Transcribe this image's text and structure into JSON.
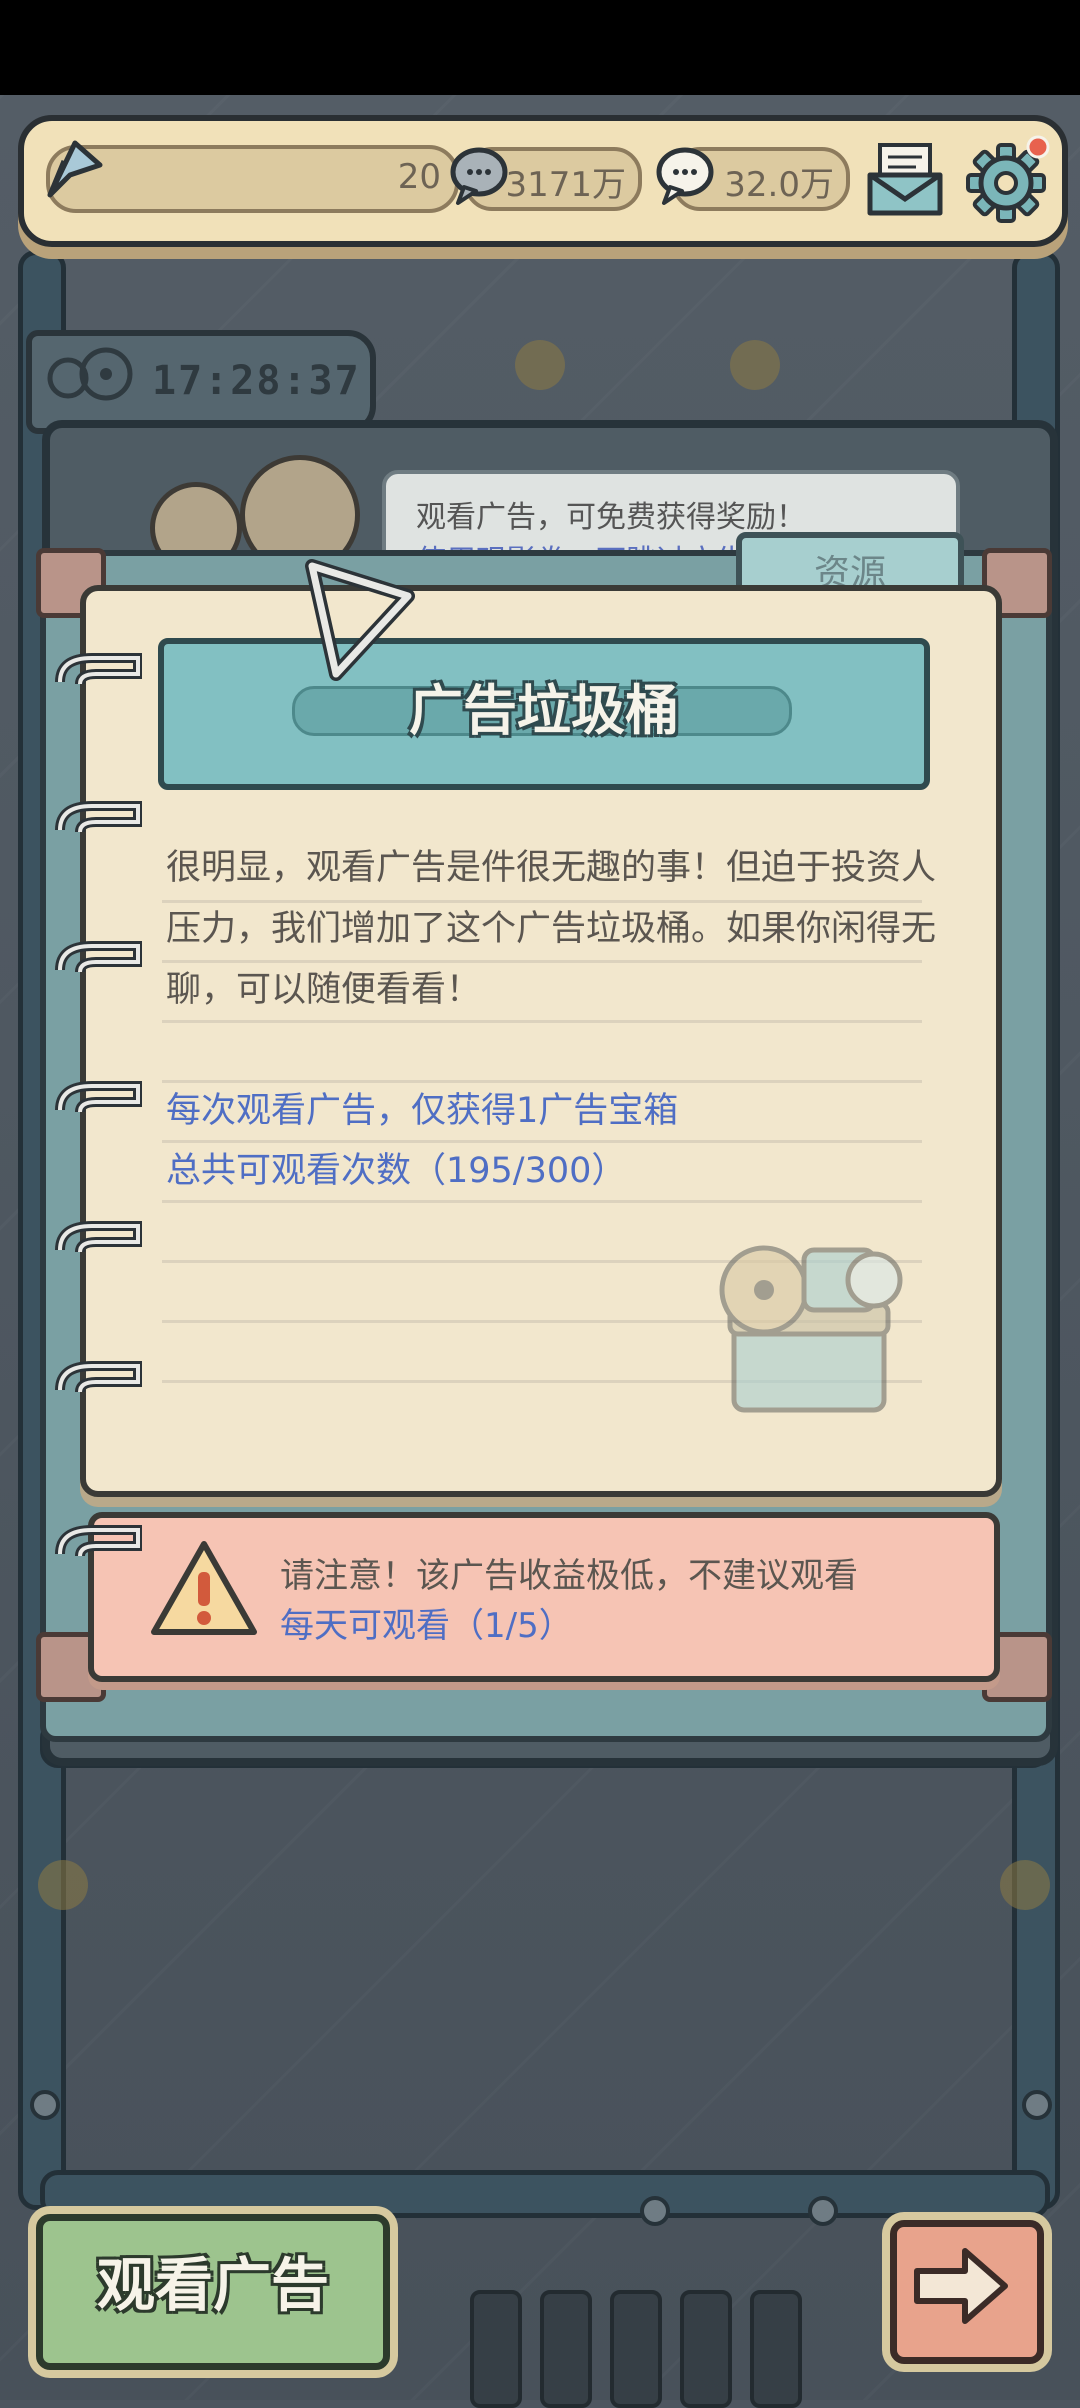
{
  "topbar": {
    "level_value": "20",
    "currency_1": "3171万",
    "currency_2": "32.0万"
  },
  "timer": {
    "value": "17:28:37"
  },
  "behind_hint": {
    "line1": "观看广告，可免费获得奖励！",
    "line2": "使用观影券，可跳过广告"
  },
  "dialog": {
    "tab_label": "资源",
    "title": "广告垃圾桶",
    "body": "很明显，观看广告是件很无趣的事！但迫于投资人压力，我们增加了这个广告垃圾桶。如果你闲得无聊，可以随便看看！",
    "reward_line": "每次观看广告，仅获得1广告宝箱",
    "total_line": "总共可观看次数（195/300）"
  },
  "warning": {
    "line1": "请注意！该广告收益极低，不建议观看",
    "line2": "每天可观看（1/5）"
  },
  "buttons": {
    "watch_ad": "观看广告"
  },
  "colors": {
    "paper": "#f2e7cd",
    "title_plate": "#82c0c2",
    "highlight_text": "#4f6ec4",
    "warning_bg": "#f6c4b4",
    "watch_button": "#9dc48e",
    "next_button": "#e8a38c"
  },
  "icons": [
    "flag-icon",
    "speech-bubble-icon",
    "mail-icon",
    "gear-icon",
    "film-reel-icon",
    "triangle-pin-icon",
    "ad-chest-icon",
    "warning-icon",
    "arrow-right-icon"
  ]
}
